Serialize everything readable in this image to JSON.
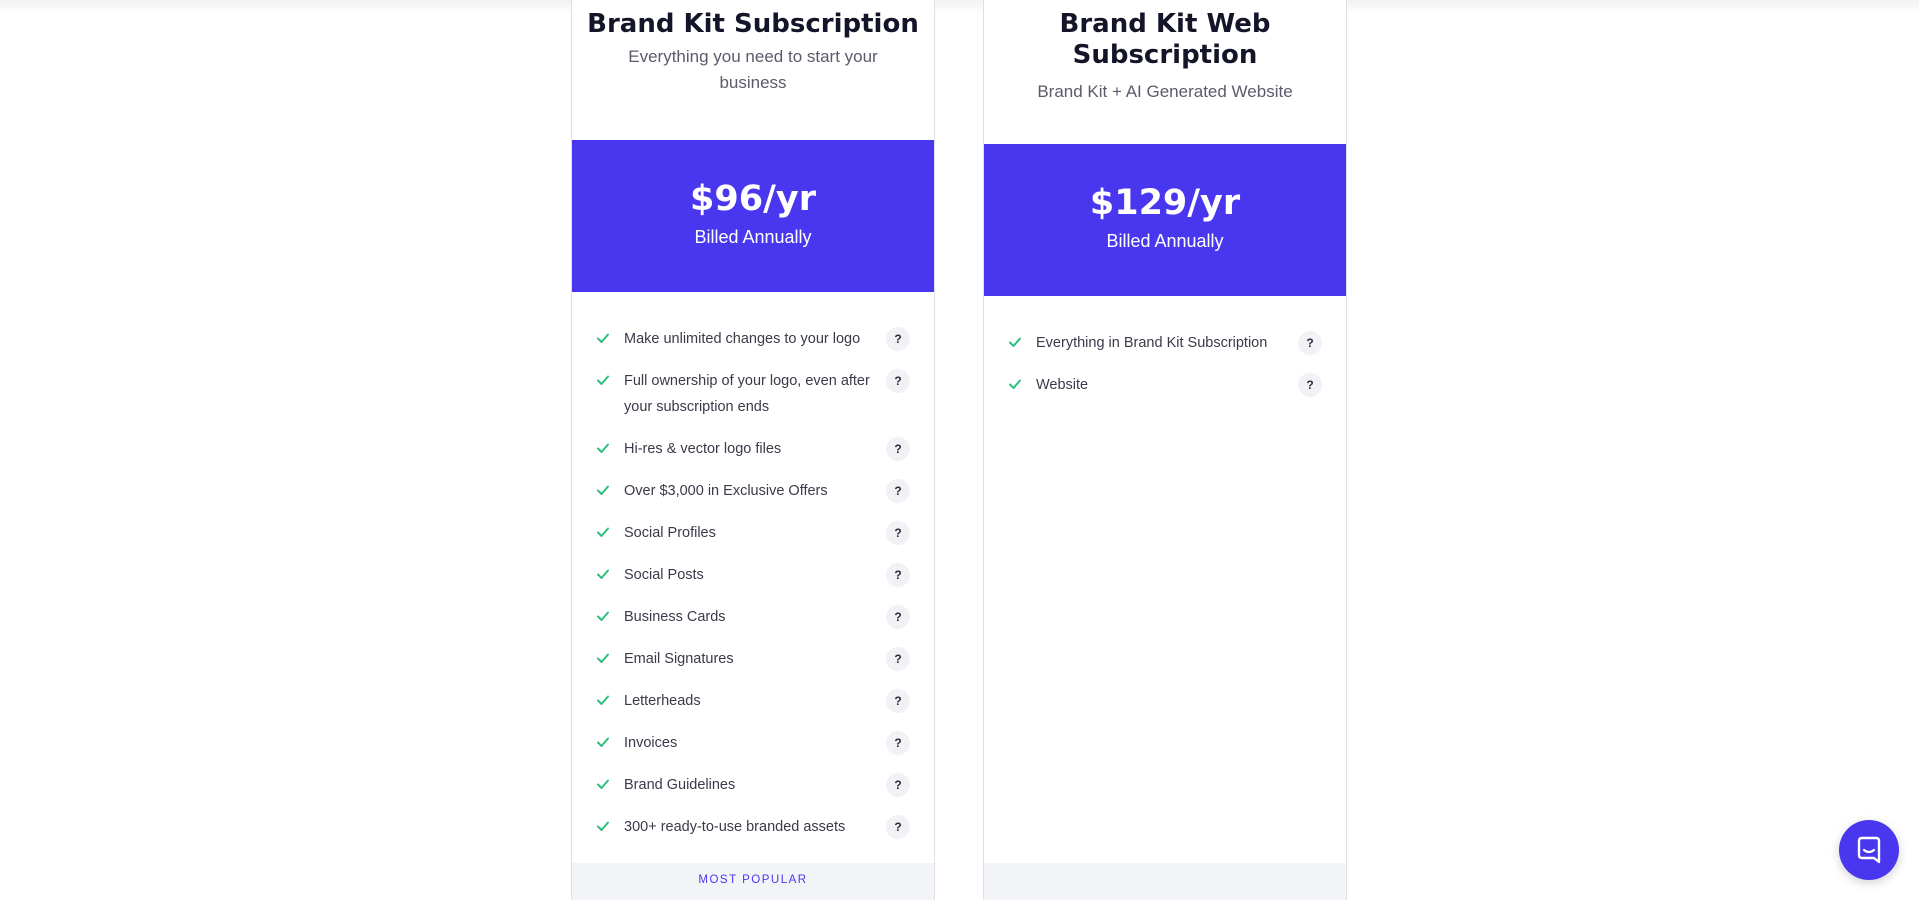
{
  "colors": {
    "accent": "#4937f0",
    "check": "#2ebf7d",
    "footer_bg": "#f3f4f8",
    "border": "#dcdfe6"
  },
  "plans": [
    {
      "title": "Brand Kit Subscription",
      "subtitle": "Everything you need to start your business",
      "price": "$96/yr",
      "billing": "Billed Annually",
      "features": [
        {
          "label": "Make unlimited changes to your logo",
          "help": "?"
        },
        {
          "label": "Full ownership of your logo, even after your subscription ends",
          "help": "?"
        },
        {
          "label": "Hi-res & vector logo files",
          "help": "?"
        },
        {
          "label": "Over $3,000 in Exclusive Offers",
          "help": "?"
        },
        {
          "label": "Social Profiles",
          "help": "?"
        },
        {
          "label": "Social Posts",
          "help": "?"
        },
        {
          "label": "Business Cards",
          "help": "?"
        },
        {
          "label": "Email Signatures",
          "help": "?"
        },
        {
          "label": "Letterheads",
          "help": "?"
        },
        {
          "label": "Invoices",
          "help": "?"
        },
        {
          "label": "Brand Guidelines",
          "help": "?"
        },
        {
          "label": "300+ ready-to-use branded assets",
          "help": "?"
        }
      ],
      "footer": "MOST POPULAR"
    },
    {
      "title": "Brand Kit Web Subscription",
      "subtitle": "Brand Kit + AI Generated Website",
      "price": "$129/yr",
      "billing": "Billed Annually",
      "features": [
        {
          "label": "Everything in Brand Kit Subscription",
          "help": "?"
        },
        {
          "label": "Website",
          "help": "?"
        }
      ],
      "footer": ""
    }
  ],
  "chat": {
    "icon": "chat-bubble-icon"
  }
}
